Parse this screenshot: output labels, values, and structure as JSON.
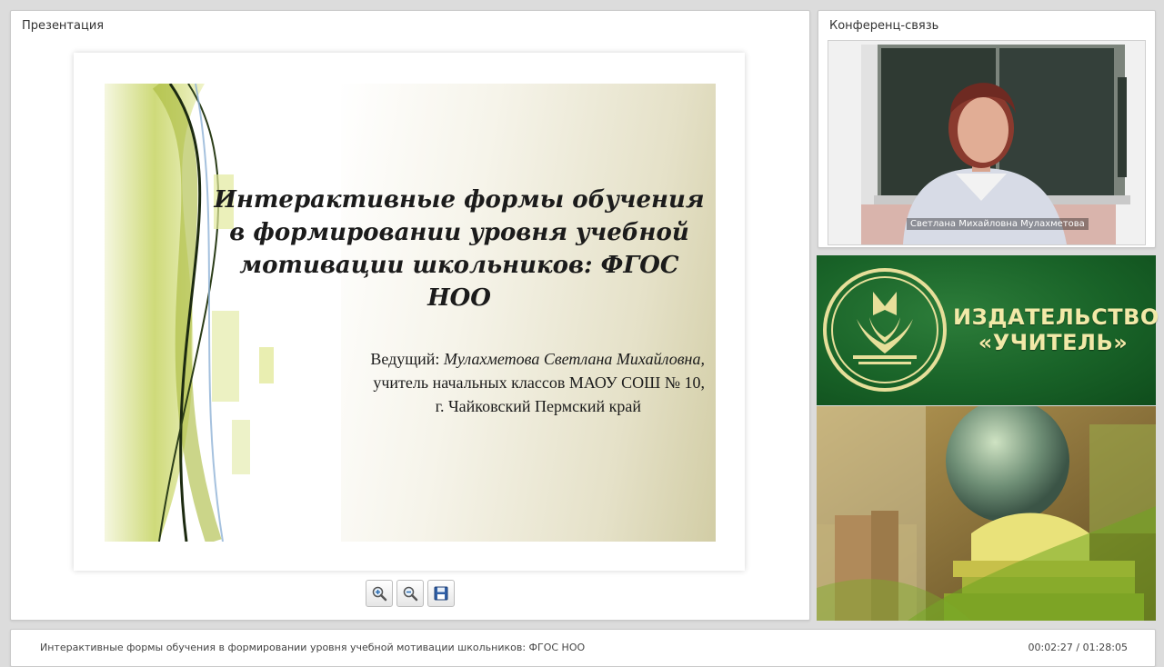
{
  "presentation": {
    "title": "Презентация",
    "slide": {
      "title": "Интерактивные формы обучения в формировании уровня учебной мотивации школьников: ФГОС НОО",
      "presenter_label": "Ведущий: ",
      "presenter_name": "Мулахметова Светлана Михайловна,",
      "presenter_role": "учитель начальных классов МАОУ СОШ № 10,",
      "presenter_location": "г. Чайковский Пермский край"
    }
  },
  "toolbar": {
    "zoom_in_icon": "zoom-in-icon",
    "zoom_out_icon": "zoom-out-icon",
    "save_icon": "save-icon"
  },
  "conference": {
    "title": "Конференц-связь",
    "participant_name": "Светлана Михайловна Мулахметова"
  },
  "publisher": {
    "line1": "ИЗДАТЕЛЬСТВО",
    "line2": "«УЧИТЕЛЬ»"
  },
  "footer": {
    "title": "Интерактивные формы обучения в формировании уровня учебной мотивации школьников: ФГОС НОО",
    "time": "00:02:27 / 01:28:05"
  },
  "colors": {
    "publisher_green": "#196328",
    "publisher_text": "#f2e9a8"
  }
}
